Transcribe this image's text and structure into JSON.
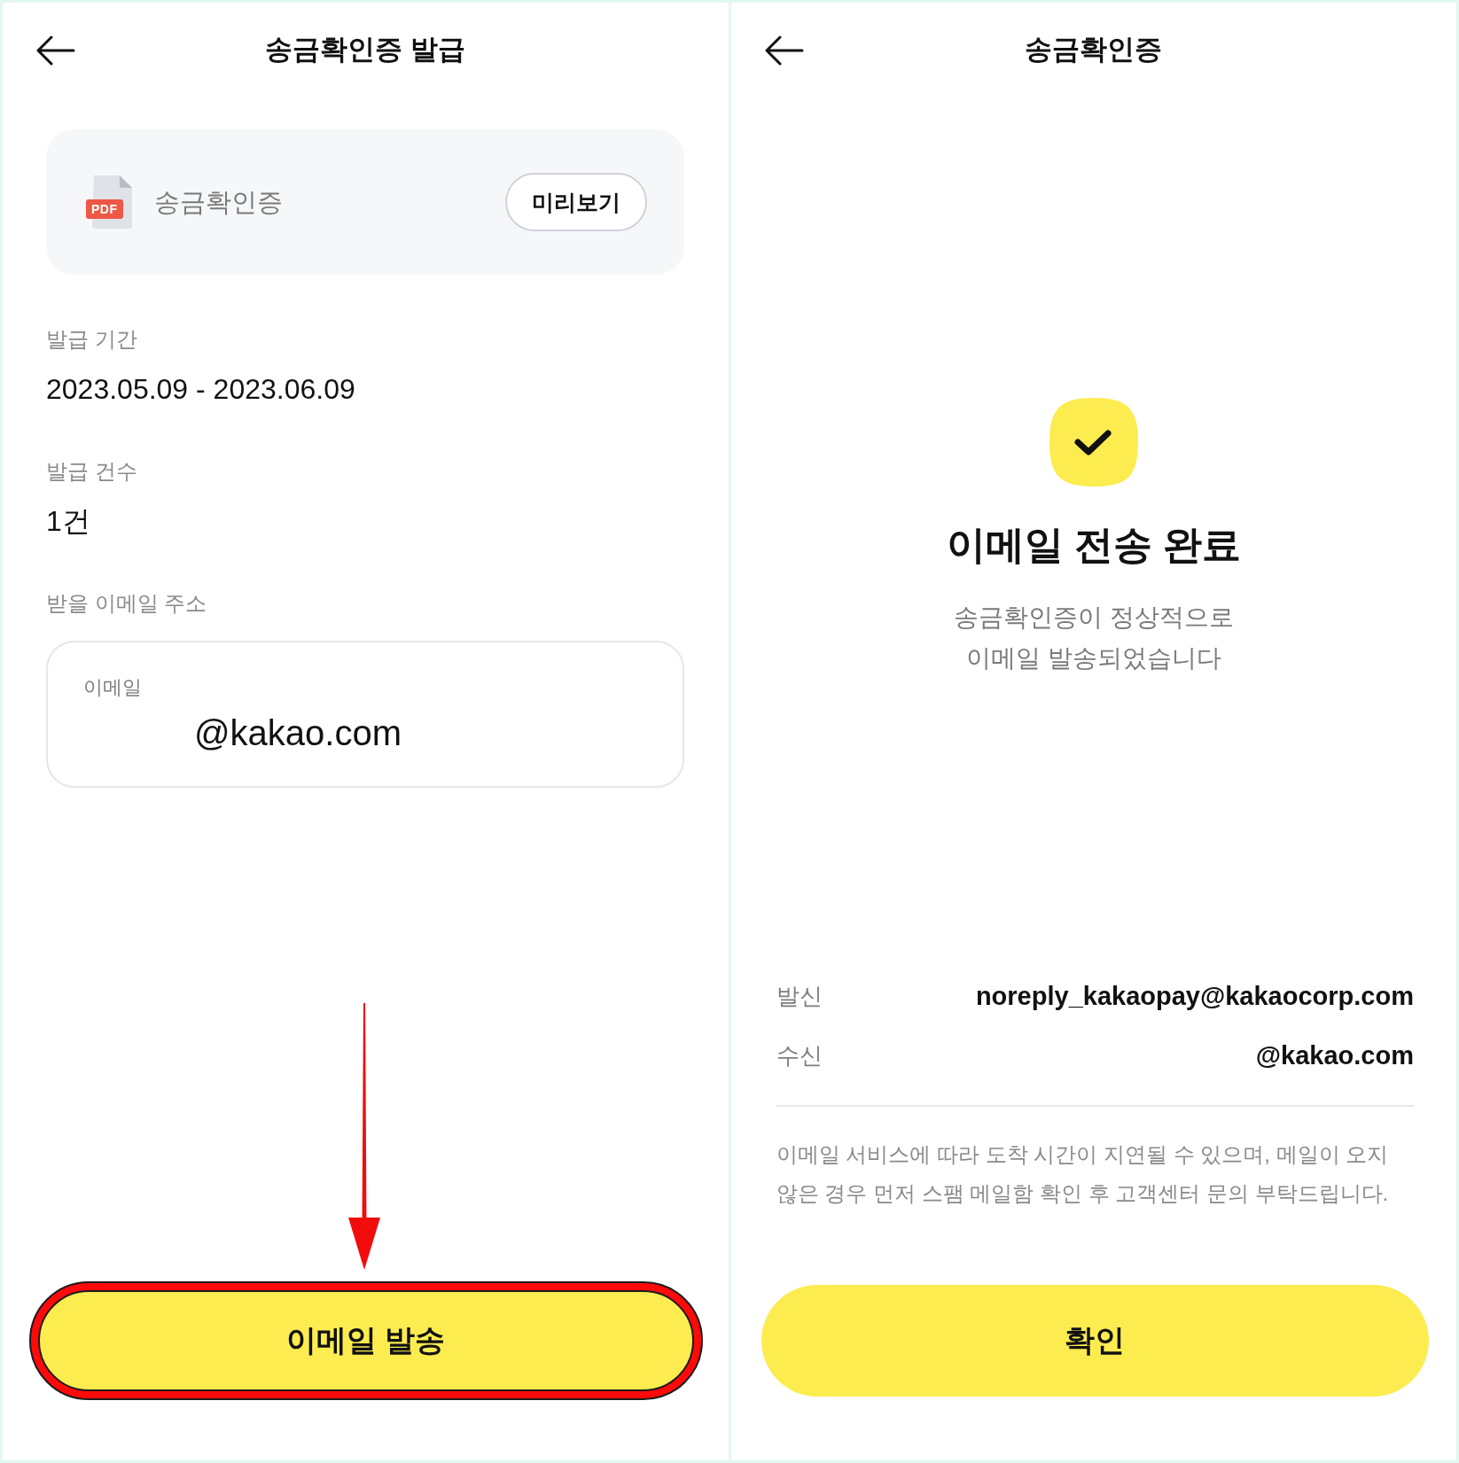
{
  "issue_screen": {
    "header": {
      "title": "송금확인증 발급"
    },
    "document_card": {
      "name": "송금확인증",
      "file_type": "PDF",
      "preview_button": "미리보기"
    },
    "fields": [
      {
        "label": "발급 기간",
        "value": "2023.05.09 - 2023.06.09"
      },
      {
        "label": "발급 건수",
        "value": "1건"
      }
    ],
    "email": {
      "section_label": "받을 이메일 주소",
      "field_label": "이메일",
      "value": "@kakao.com"
    },
    "submit_button": {
      "label": "이메일 발송",
      "highlighted": true
    }
  },
  "complete_screen": {
    "header": {
      "title": "송금확인증"
    },
    "title": "이메일 전송 완료",
    "message_lines": [
      "송금확인증이 정상적으로",
      "이메일 발송되었습니다"
    ],
    "details": [
      {
        "label": "발신",
        "value": "noreply_kakaopay@kakaocorp.com"
      },
      {
        "label": "수신",
        "value": "@kakao.com"
      }
    ],
    "notice": "이메일 서비스에 따라 도착 시간이 지연될 수 있으며, 메일이 오지 않은 경우 먼저 스팸 메일함 확인 후 고객센터 문의 부탁드립니다.",
    "confirm_button": "확인"
  }
}
